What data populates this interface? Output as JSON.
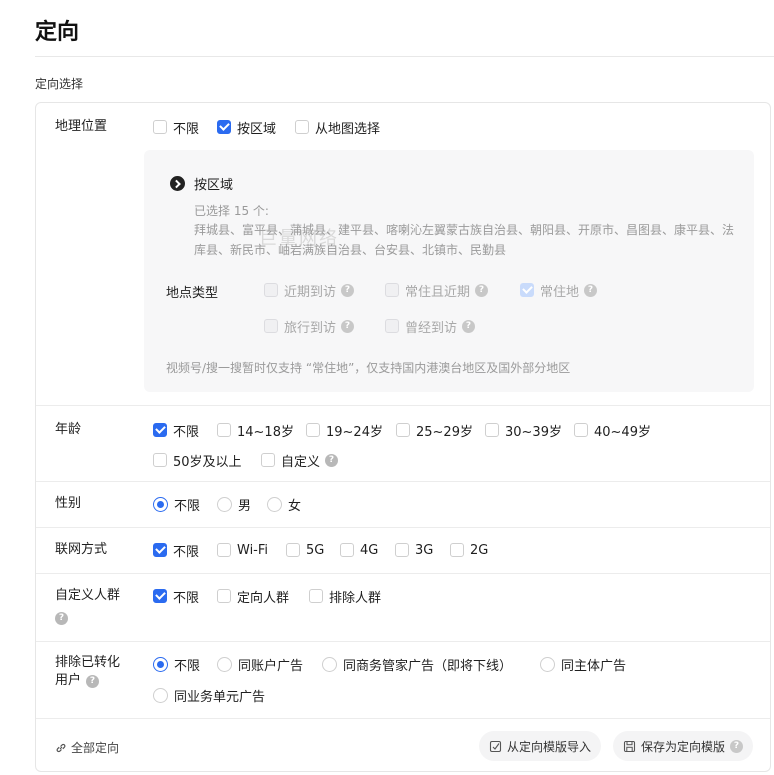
{
  "page": {
    "title": "定向",
    "section_title": "定向选择"
  },
  "geo": {
    "label": "地理位置",
    "options": [
      {
        "label": "不限",
        "checked": false
      },
      {
        "label": "按区域",
        "checked": true
      },
      {
        "label": "从地图选择",
        "checked": false
      }
    ],
    "region": {
      "title": "按区域",
      "selected_count": "已选择 15 个:",
      "selected_list": "拜城县、富平县、蒲城县、建平县、喀喇沁左翼蒙古族自治县、朝阳县、开原市、昌图县、康平县、法库县、新民市、岫岩满族自治县、台安县、北镇市、民勤县",
      "watermark": "巨量网络",
      "location_type_label": "地点类型",
      "location_types": [
        {
          "label": "近期到访",
          "checked": false
        },
        {
          "label": "常住且近期",
          "checked": false
        },
        {
          "label": "常住地",
          "checked": true
        },
        {
          "label": "旅行到访",
          "checked": false
        },
        {
          "label": "曾经到访",
          "checked": false
        }
      ],
      "note": "视频号/搜一搜暂时仅支持 “常住地”，仅支持国内港澳台地区及国外部分地区"
    }
  },
  "age": {
    "label": "年龄",
    "options": [
      {
        "label": "不限",
        "checked": true
      },
      {
        "label": "14~18岁",
        "checked": false
      },
      {
        "label": "19~24岁",
        "checked": false
      },
      {
        "label": "25~29岁",
        "checked": false
      },
      {
        "label": "30~39岁",
        "checked": false
      },
      {
        "label": "40~49岁",
        "checked": false
      },
      {
        "label": "50岁及以上",
        "checked": false
      },
      {
        "label": "自定义",
        "checked": false
      }
    ]
  },
  "gender": {
    "label": "性别",
    "options": [
      {
        "label": "不限",
        "selected": true
      },
      {
        "label": "男",
        "selected": false
      },
      {
        "label": "女",
        "selected": false
      }
    ]
  },
  "network": {
    "label": "联网方式",
    "options": [
      {
        "label": "不限",
        "checked": true
      },
      {
        "label": "Wi-Fi",
        "checked": false
      },
      {
        "label": "5G",
        "checked": false
      },
      {
        "label": "4G",
        "checked": false
      },
      {
        "label": "3G",
        "checked": false
      },
      {
        "label": "2G",
        "checked": false
      }
    ]
  },
  "audience": {
    "label": "自定义人群",
    "options": [
      {
        "label": "不限",
        "checked": true
      },
      {
        "label": "定向人群",
        "checked": false
      },
      {
        "label": "排除人群",
        "checked": false
      }
    ]
  },
  "exclude": {
    "label_line1": "排除已转化",
    "label_line2": "用户",
    "options": [
      {
        "label": "不限",
        "selected": true
      },
      {
        "label": "同账户广告",
        "selected": false
      },
      {
        "label": "同商务管家广告（即将下线）",
        "selected": false
      },
      {
        "label": "同主体广告",
        "selected": false
      },
      {
        "label": "同业务单元广告",
        "selected": false
      }
    ]
  },
  "footer": {
    "all_targeting": "全部定向",
    "import_template": "从定向模版导入",
    "save_template": "保存为定向模版"
  },
  "colors": {
    "accent": "#2b6bf0",
    "help_icon": "#b8b8b8"
  }
}
